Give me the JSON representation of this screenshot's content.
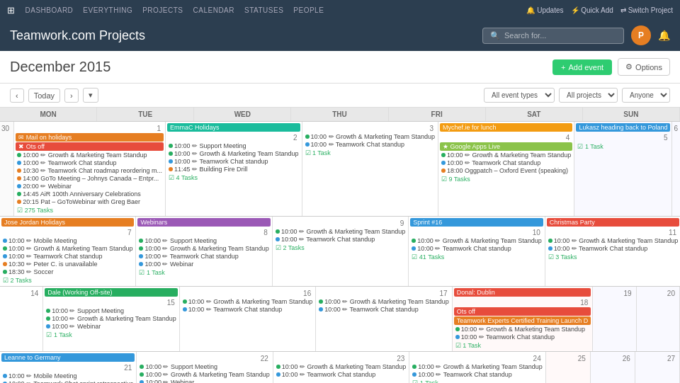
{
  "app": {
    "title": "Teamwork.com Projects",
    "nav_items": [
      "DASHBOARD",
      "EVERYTHING",
      "PROJECTS",
      "CALENDAR",
      "STATUSES",
      "PEOPLE"
    ],
    "top_right": [
      "Updates",
      "Quick Add",
      "Switch Project"
    ],
    "search_placeholder": "Search for..."
  },
  "calendar": {
    "month_title": "December 2015",
    "add_btn": "Add event",
    "options_btn": "Options",
    "today_btn": "Today",
    "filters": {
      "event_types": "All event types",
      "projects": "All projects",
      "person": "Anyone"
    },
    "days": [
      "MON",
      "TUE",
      "WED",
      "THU",
      "FRI",
      "SAT",
      "SUN"
    ]
  }
}
